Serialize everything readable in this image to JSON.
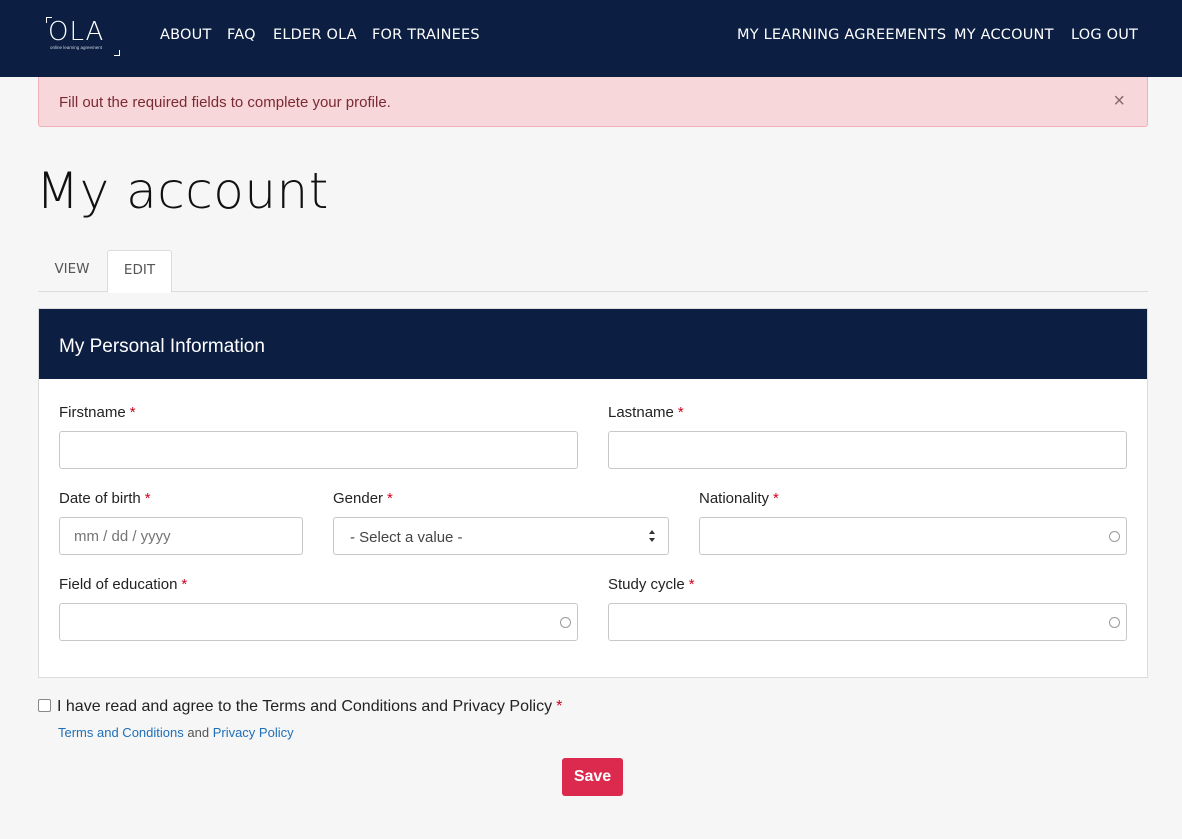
{
  "brand": {
    "logo_text": "OLA",
    "logo_subtitle": "online learning agreement"
  },
  "nav": {
    "left": [
      "ABOUT",
      "FAQ",
      "ELDER OLA",
      "FOR TRAINEES"
    ],
    "right": [
      "MY LEARNING AGREEMENTS",
      "MY ACCOUNT",
      "LOG OUT"
    ]
  },
  "alert": {
    "message": "Fill out the required fields to complete your profile.",
    "close": "×"
  },
  "page_title": "My account",
  "tabs": [
    "VIEW",
    "EDIT"
  ],
  "active_tab": "EDIT",
  "panel": {
    "title": "My Personal Information"
  },
  "form": {
    "required_mark": "*",
    "firstname_label": "Firstname",
    "firstname_value": "",
    "lastname_label": "Lastname",
    "lastname_value": "",
    "dob_label": "Date of birth",
    "dob_placeholder": "mm / dd / yyyy",
    "gender_label": "Gender",
    "gender_selected": "- Select a value -",
    "nationality_label": "Nationality",
    "nationality_value": "",
    "field_of_education_label": "Field of education",
    "field_of_education_value": "",
    "study_cycle_label": "Study cycle",
    "study_cycle_value": ""
  },
  "terms": {
    "agree_text": "I have read and agree to the Terms and Conditions and Privacy Policy",
    "checked": false,
    "terms_link": "Terms and Conditions",
    "and": "and",
    "privacy_link": "Privacy Policy"
  },
  "save_button": "Save",
  "colors": {
    "navy": "#0c1f42",
    "alert_bg": "#f8d7da",
    "save": "#db2a4d",
    "link": "#1e6fb8",
    "required": "#d0021b"
  }
}
